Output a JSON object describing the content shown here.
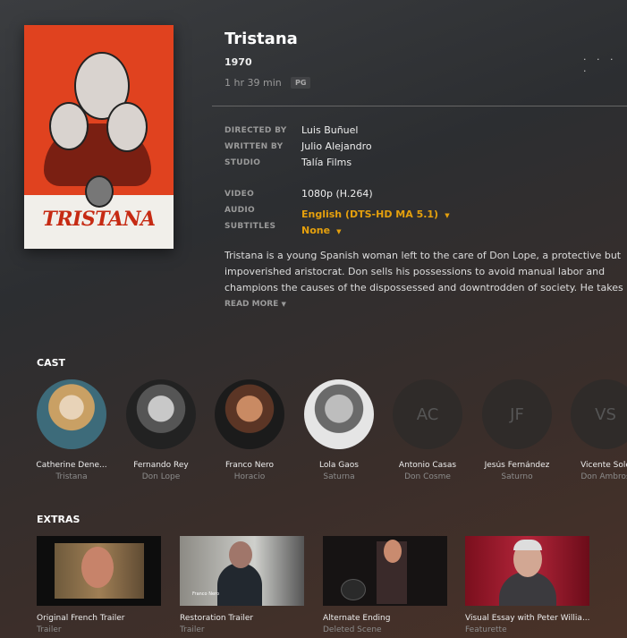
{
  "movie": {
    "title": "Tristana",
    "year": "1970",
    "runtime": "1 hr 39 min",
    "rating": "PG",
    "more": "· · · ·",
    "poster_title": "TRISTANA"
  },
  "details": [
    {
      "label": "DIRECTED BY",
      "value": "Luis Buñuel"
    },
    {
      "label": "WRITTEN BY",
      "value": "Julio Alejandro"
    },
    {
      "label": "STUDIO",
      "value": "Talía Films"
    }
  ],
  "media": {
    "video_label": "VIDEO",
    "video_value": "1080p (H.264)",
    "audio_label": "AUDIO",
    "audio_value": "English (DTS-HD MA 5.1)",
    "subtitles_label": "SUBTITLES",
    "subtitles_value": "None"
  },
  "summary": "Tristana is a young Spanish woman left to the care of Don Lope, a protective but impoverished aristocrat. Don sells his possessions to avoid manual labor and champions the causes of the dispossessed and downtrodden of society. He takes advantage of the vulnerable Tristana",
  "read_more": "READ MORE",
  "cast_heading": "CAST",
  "cast": [
    {
      "name": "Catherine Dene...",
      "role": "Tristana",
      "initials": ""
    },
    {
      "name": "Fernando Rey",
      "role": "Don Lope",
      "initials": ""
    },
    {
      "name": "Franco Nero",
      "role": "Horacio",
      "initials": ""
    },
    {
      "name": "Lola Gaos",
      "role": "Saturna",
      "initials": ""
    },
    {
      "name": "Antonio Casas",
      "role": "Don Cosme",
      "initials": "AC"
    },
    {
      "name": "Jesús Fernández",
      "role": "Saturno",
      "initials": "JF"
    },
    {
      "name": "Vicente Sole",
      "role": "Don Ambros",
      "initials": "VS"
    }
  ],
  "extras_heading": "EXTRAS",
  "extras": [
    {
      "name": "Original French Trailer",
      "type": "Trailer"
    },
    {
      "name": "Restoration Trailer",
      "type": "Trailer",
      "caption": "Franco Nero"
    },
    {
      "name": "Alternate Ending",
      "type": "Deleted Scene"
    },
    {
      "name": "Visual Essay with Peter Willia...",
      "type": "Featurette"
    }
  ],
  "colors": {
    "accent": "#e5a00d",
    "poster_red": "#e0421f"
  }
}
